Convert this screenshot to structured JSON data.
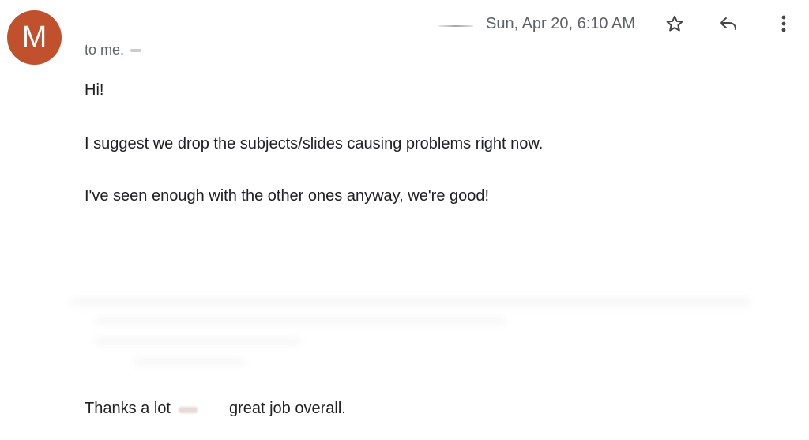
{
  "message": {
    "sender_initial": "M",
    "date": "Sun, Apr 20, 6:10 AM",
    "to_label": "to me,",
    "greeting": "Hi!",
    "paragraph_1": "I suggest we drop the subjects/slides causing problems right now.",
    "paragraph_2": "I've seen enough with the other ones anyway, we're good!",
    "thanks_prefix": "Thanks a lot",
    "thanks_suffix": "great job overall."
  },
  "icons": {
    "star": "star-icon",
    "reply": "reply-icon",
    "more": "more-vertical-icon"
  },
  "colors": {
    "avatar": "#c1502d",
    "text": "#202124",
    "secondary_text": "#5f6368"
  }
}
